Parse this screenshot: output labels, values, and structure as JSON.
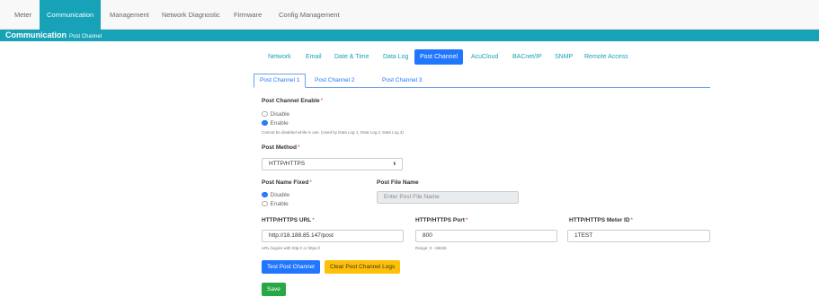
{
  "nav": {
    "items": [
      "Meter",
      "Communication",
      "Management",
      "Network Diagnostic",
      "Firmware",
      "Config Management"
    ]
  },
  "header": {
    "title": "Communication",
    "subtitle": "Post Channel"
  },
  "subtabs": [
    "Network",
    "Email",
    "Date & Time",
    "Data Log",
    "Post Channel",
    "AcuCloud",
    "BACnet/IP",
    "SNMP",
    "Remote Access"
  ],
  "channel_tabs": [
    "Post Channel 1",
    "Post Channel 2",
    "Post Channel 3"
  ],
  "form": {
    "required_mark": "*",
    "enable": {
      "label": "Post Channel Enable",
      "options": [
        "Disable",
        "Enable"
      ],
      "help": "Cannot be disabled while in use. (Used by Data Log 1, Data Log 2, Data Log 3)"
    },
    "method": {
      "label": "Post Method",
      "value": "HTTP/HTTPS",
      "caret": "⬍"
    },
    "name_fixed": {
      "label": "Post Name Fixed",
      "options": [
        "Disable",
        "Enable"
      ]
    },
    "file_name": {
      "label": "Post File Name",
      "placeholder": "Enter Post File Name"
    },
    "url": {
      "label": "HTTP/HTTPS URL",
      "value": "http://18.188.85.147/post",
      "help": "URL begins with http:// or https://"
    },
    "port": {
      "label": "HTTP/HTTPS Port",
      "value": "800",
      "help": "Range: 0 - 65535"
    },
    "meter_id": {
      "label": "HTTP/HTTPS Meter ID",
      "value": "1TEST"
    }
  },
  "buttons": {
    "test": "Test Post Channel",
    "clear": "Clear Post Channel Logs",
    "save": "Save"
  },
  "colors": {
    "accent": "#17a2b8",
    "primary": "#2176ff",
    "warning": "#ffc107",
    "success": "#28a745"
  }
}
